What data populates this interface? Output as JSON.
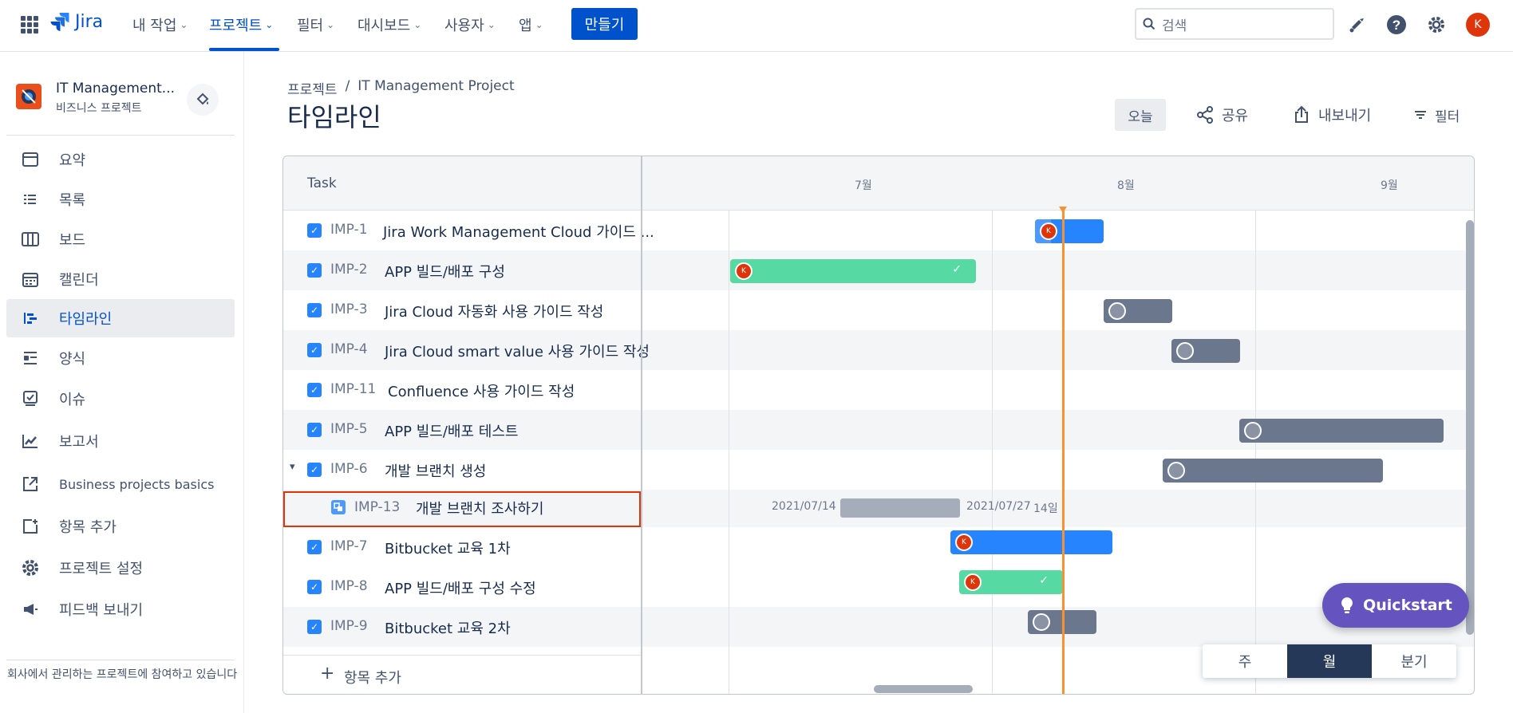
{
  "topnav": {
    "logo": "Jira",
    "items": [
      {
        "label": "내 작업"
      },
      {
        "label": "프로젝트"
      },
      {
        "label": "필터"
      },
      {
        "label": "대시보드"
      },
      {
        "label": "사용자"
      },
      {
        "label": "앱"
      }
    ],
    "create_label": "만들기",
    "search_placeholder": "검색",
    "avatar_initial": "K"
  },
  "sidebar": {
    "project_name": "IT Management...",
    "project_type": "비즈니스 프로젝트",
    "items": [
      {
        "label": "요약",
        "icon": "summary-icon"
      },
      {
        "label": "목록",
        "icon": "list-icon"
      },
      {
        "label": "보드",
        "icon": "board-icon"
      },
      {
        "label": "캘린더",
        "icon": "calendar-icon"
      },
      {
        "label": "타임라인",
        "icon": "timeline-icon"
      },
      {
        "label": "양식",
        "icon": "form-icon"
      },
      {
        "label": "이슈",
        "icon": "issue-icon"
      },
      {
        "label": "보고서",
        "icon": "report-icon"
      },
      {
        "label": "Business projects basics",
        "icon": "external-link-icon"
      },
      {
        "label": "항목 추가",
        "icon": "add-item-icon"
      },
      {
        "label": "프로젝트 설정",
        "icon": "gear-icon"
      },
      {
        "label": "피드백 보내기",
        "icon": "megaphone-icon"
      }
    ],
    "footer": "회사에서 관리하는 프로젝트에 참여하고 있습니다"
  },
  "page": {
    "breadcrumb_root": "프로젝트",
    "breadcrumb_sep": "/",
    "breadcrumb_project": "IT Management Project",
    "title": "타임라인",
    "today_label": "오늘",
    "share_label": "공유",
    "export_label": "내보내기",
    "filter_label": "필터"
  },
  "timeline": {
    "task_header": "Task",
    "months": [
      "7월",
      "8월",
      "9월"
    ],
    "rows": [
      {
        "key": "IMP-1",
        "summary": "Jira Work Management Cloud 가이드 ..."
      },
      {
        "key": "IMP-2",
        "summary": "APP 빌드/배포 구성"
      },
      {
        "key": "IMP-3",
        "summary": "Jira Cloud 자동화 사용 가이드 작성"
      },
      {
        "key": "IMP-4",
        "summary": "Jira Cloud smart value 사용 가이드 작성"
      },
      {
        "key": "IMP-11",
        "summary": "Confluence 사용 가이드 작성"
      },
      {
        "key": "IMP-5",
        "summary": "APP 빌드/배포 테스트"
      },
      {
        "key": "IMP-6",
        "summary": "개발 브랜치 생성"
      },
      {
        "key": "IMP-13",
        "summary": "개발 브랜치 조사하기"
      },
      {
        "key": "IMP-7",
        "summary": "Bitbucket 교육 1차"
      },
      {
        "key": "IMP-8",
        "summary": "APP 빌드/배포 구성 수정"
      },
      {
        "key": "IMP-9",
        "summary": "Bitbucket 교육 2차"
      }
    ],
    "subtask_start": "2021/07/14",
    "subtask_end": "2021/07/27",
    "subtask_duration": "14일",
    "add_item_label": "항목 추가",
    "avatar_initial": "K",
    "colors": {
      "in_progress": "#2684ff",
      "done": "#57d9a3",
      "todo": "#6b778c",
      "today": "#f79233"
    }
  },
  "quickstart_label": "Quickstart",
  "scale": {
    "week": "주",
    "month": "월",
    "quarter": "분기",
    "selected": "월"
  }
}
